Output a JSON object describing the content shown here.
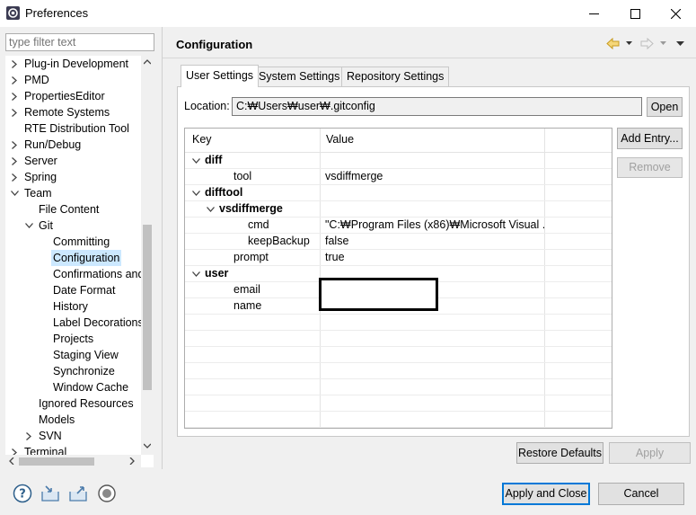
{
  "window": {
    "title": "Preferences",
    "controls": {
      "minimize": "minimize-icon",
      "maximize": "maximize-icon",
      "close": "close-icon"
    }
  },
  "filter": {
    "placeholder": "type filter text"
  },
  "tree": {
    "items": [
      {
        "label": "Plug-in Development",
        "level": 0,
        "twisty": "collapsed"
      },
      {
        "label": "PMD",
        "level": 0,
        "twisty": "collapsed"
      },
      {
        "label": "PropertiesEditor",
        "level": 0,
        "twisty": "collapsed"
      },
      {
        "label": "Remote Systems",
        "level": 0,
        "twisty": "collapsed"
      },
      {
        "label": "RTE Distribution Tool",
        "level": 0,
        "twisty": "none"
      },
      {
        "label": "Run/Debug",
        "level": 0,
        "twisty": "collapsed"
      },
      {
        "label": "Server",
        "level": 0,
        "twisty": "collapsed"
      },
      {
        "label": "Spring",
        "level": 0,
        "twisty": "collapsed"
      },
      {
        "label": "Team",
        "level": 0,
        "twisty": "expanded"
      },
      {
        "label": "File Content",
        "level": 1,
        "twisty": "none"
      },
      {
        "label": "Git",
        "level": 1,
        "twisty": "expanded"
      },
      {
        "label": "Committing",
        "level": 2,
        "twisty": "none"
      },
      {
        "label": "Configuration",
        "level": 2,
        "twisty": "none",
        "selected": true
      },
      {
        "label": "Confirmations and",
        "level": 2,
        "twisty": "none"
      },
      {
        "label": "Date Format",
        "level": 2,
        "twisty": "none"
      },
      {
        "label": "History",
        "level": 2,
        "twisty": "none"
      },
      {
        "label": "Label Decorations",
        "level": 2,
        "twisty": "none"
      },
      {
        "label": "Projects",
        "level": 2,
        "twisty": "none"
      },
      {
        "label": "Staging View",
        "level": 2,
        "twisty": "none"
      },
      {
        "label": "Synchronize",
        "level": 2,
        "twisty": "none"
      },
      {
        "label": "Window Cache",
        "level": 2,
        "twisty": "none"
      },
      {
        "label": "Ignored Resources",
        "level": 1,
        "twisty": "none"
      },
      {
        "label": "Models",
        "level": 1,
        "twisty": "none"
      },
      {
        "label": "SVN",
        "level": 1,
        "twisty": "collapsed"
      },
      {
        "label": "Terminal",
        "level": 0,
        "twisty": "collapsed"
      }
    ]
  },
  "page": {
    "title": "Configuration",
    "nav_icons": [
      "back-arrow-icon",
      "back-menu-icon",
      "forward-arrow-icon",
      "forward-menu-icon",
      "view-menu-icon"
    ],
    "tabs": [
      {
        "label": "User Settings",
        "active": true
      },
      {
        "label": "System Settings",
        "active": false
      },
      {
        "label": "Repository Settings",
        "active": false
      }
    ],
    "location": {
      "label": "Location:",
      "value": "C:₩Users₩user₩.gitconfig",
      "open_button": "Open"
    },
    "table": {
      "columns": [
        "Key",
        "Value"
      ],
      "rows": [
        {
          "key": "diff",
          "value": "",
          "indent": 0,
          "section": true
        },
        {
          "key": "tool",
          "value": "vsdiffmerge",
          "indent": 2,
          "section": false
        },
        {
          "key": "difftool",
          "value": "",
          "indent": 0,
          "section": true
        },
        {
          "key": "vsdiffmerge",
          "value": "",
          "indent": 1,
          "section": true
        },
        {
          "key": "cmd",
          "value": "\"C:₩Program Files (x86)₩Microsoft Visual ...",
          "indent": 3,
          "section": false
        },
        {
          "key": "keepBackup",
          "value": "false",
          "indent": 3,
          "section": false
        },
        {
          "key": "prompt",
          "value": "true",
          "indent": 2,
          "section": false
        },
        {
          "key": "user",
          "value": "",
          "indent": 0,
          "section": true
        },
        {
          "key": "email",
          "value": "",
          "indent": 2,
          "section": false
        },
        {
          "key": "name",
          "value": "",
          "indent": 2,
          "section": false
        }
      ]
    },
    "buttons": {
      "add_entry": "Add Entry...",
      "remove": "Remove",
      "restore_defaults": "Restore Defaults",
      "apply": "Apply"
    }
  },
  "footer": {
    "icons": [
      "help-icon",
      "import-icon",
      "export-icon",
      "record-icon"
    ],
    "apply_and_close": "Apply and Close",
    "cancel": "Cancel"
  },
  "colors": {
    "selection": "#cce8ff",
    "accent": "#0078d7",
    "forward_arrow": "#c8c8c8",
    "back_arrow": "#e6b422"
  }
}
